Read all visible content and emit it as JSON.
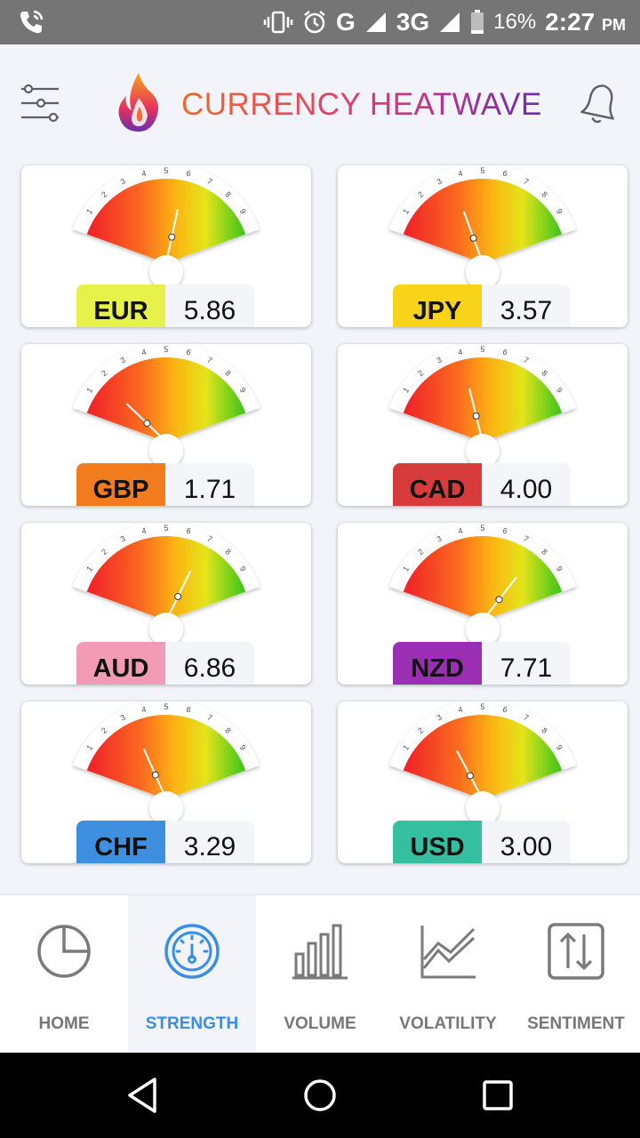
{
  "status_bar": {
    "network": "G",
    "network2": "3G",
    "battery": "16%",
    "time": "2:27",
    "ampm": "PM",
    "icons": [
      "phone-call-icon",
      "vibrate-icon",
      "alarm-icon",
      "signal-icon",
      "battery-icon"
    ]
  },
  "header": {
    "title": "CURRENCY HEATWAVE",
    "left_icon": "filter-sliders-icon",
    "right_icon": "bell-icon",
    "logo_icon": "flame-logo-icon"
  },
  "gauge_ticks": [
    "1",
    "2",
    "3",
    "4",
    "5",
    "6",
    "7",
    "8",
    "9"
  ],
  "currencies": [
    {
      "code": "EUR",
      "value": "5.86",
      "strength": 5.86,
      "color": "#e6f24a"
    },
    {
      "code": "JPY",
      "value": "3.57",
      "strength": 3.57,
      "color": "#f7d31a"
    },
    {
      "code": "GBP",
      "value": "1.71",
      "strength": 1.71,
      "color": "#f07c1e"
    },
    {
      "code": "CAD",
      "value": "4.00",
      "strength": 4.0,
      "color": "#d83b3b"
    },
    {
      "code": "AUD",
      "value": "6.86",
      "strength": 6.86,
      "color": "#f29bb7"
    },
    {
      "code": "NZD",
      "value": "7.71",
      "strength": 7.71,
      "color": "#9b2fb3"
    },
    {
      "code": "CHF",
      "value": "3.29",
      "strength": 3.29,
      "color": "#3e8fe0"
    },
    {
      "code": "USD",
      "value": "3.00",
      "strength": 3.0,
      "color": "#34bfa0"
    }
  ],
  "nav": {
    "active": "STRENGTH",
    "active_color": "#3a8ee6",
    "tabs": [
      {
        "label": "HOME",
        "icon": "pie-chart-icon"
      },
      {
        "label": "STRENGTH",
        "icon": "speedometer-icon"
      },
      {
        "label": "VOLUME",
        "icon": "bar-chart-icon"
      },
      {
        "label": "VOLATILITY",
        "icon": "line-chart-icon"
      },
      {
        "label": "SENTIMENT",
        "icon": "up-down-arrows-icon"
      }
    ]
  },
  "system_nav": [
    "back-icon",
    "home-circle-icon",
    "recents-square-icon"
  ]
}
